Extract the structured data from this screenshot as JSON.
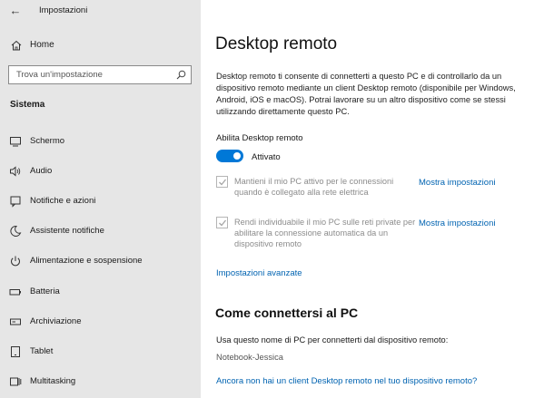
{
  "app": {
    "title": "Impostazioni"
  },
  "sidebar": {
    "home_label": "Home",
    "search_placeholder": "Trova un'impostazione",
    "section_label": "Sistema",
    "items": [
      {
        "label": "Schermo",
        "icon": "monitor-icon"
      },
      {
        "label": "Audio",
        "icon": "speaker-icon"
      },
      {
        "label": "Notifiche e azioni",
        "icon": "notification-icon"
      },
      {
        "label": "Assistente notifiche",
        "icon": "moon-icon"
      },
      {
        "label": "Alimentazione e sospensione",
        "icon": "power-icon"
      },
      {
        "label": "Batteria",
        "icon": "battery-icon"
      },
      {
        "label": "Archiviazione",
        "icon": "storage-icon"
      },
      {
        "label": "Tablet",
        "icon": "tablet-icon"
      },
      {
        "label": "Multitasking",
        "icon": "multitasking-icon"
      }
    ]
  },
  "main": {
    "title": "Desktop remoto",
    "description": "Desktop remoto ti consente di connetterti a questo PC e di controllarlo da un dispositivo remoto mediante un client Desktop remoto (disponibile per Windows, Android, iOS e macOS). Potrai lavorare su un altro dispositivo come se stessi utilizzando direttamente questo PC.",
    "toggle_label": "Abilita Desktop remoto",
    "toggle_state": "Attivato",
    "toggle_on": true,
    "options": [
      {
        "text": "Mantieni il mio PC attivo per le connessioni quando è collegato alla rete elettrica",
        "link": "Mostra impostazioni",
        "checked": true
      },
      {
        "text": "Rendi individuabile il mio PC sulle reti private per abilitare la connessione automatica da un dispositivo remoto",
        "link": "Mostra impostazioni",
        "checked": true
      }
    ],
    "advanced_link": "Impostazioni avanzate",
    "connect_title": "Come connettersi al PC",
    "pc_name_label": "Usa questo nome di PC per connetterti dal dispositivo remoto:",
    "pc_name": "Notebook-Jessica",
    "client_link": "Ancora non hai un client Desktop remoto nel tuo dispositivo remoto?"
  },
  "colors": {
    "accent": "#0078d7",
    "link": "#0063b1",
    "sidebar_bg": "#e6e6e6"
  }
}
